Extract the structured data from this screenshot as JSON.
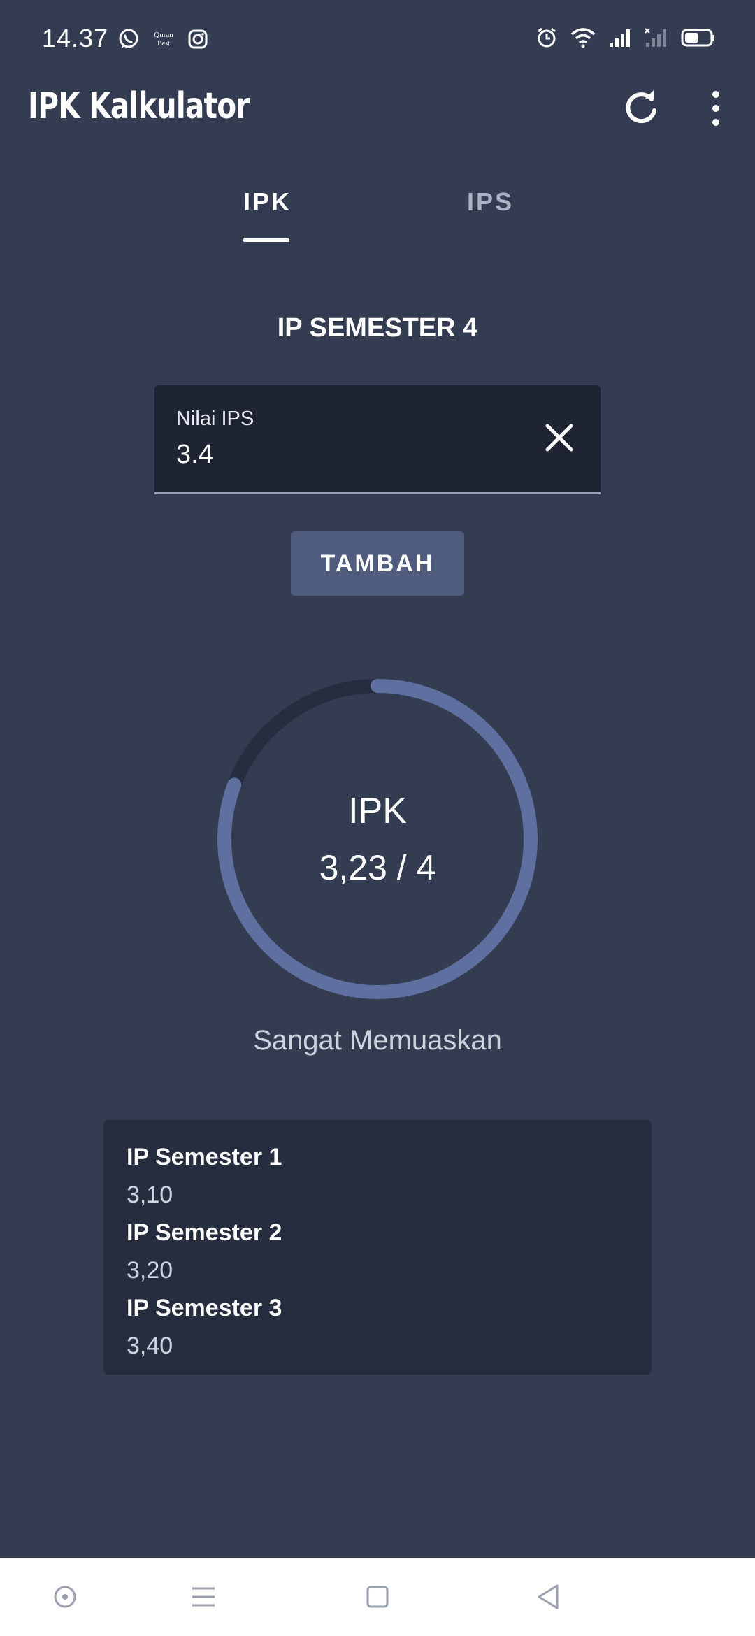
{
  "status_bar": {
    "time": "14.37",
    "app_icons": [
      "whatsapp-icon",
      "quran-best-icon",
      "instagram-icon"
    ],
    "quran_label_top": "Quran",
    "quran_label_bottom": "Best",
    "right_icons": [
      "alarm-icon",
      "wifi-icon",
      "signal-icon",
      "signal-no-service-icon",
      "battery-icon"
    ],
    "battery_level": 0.55
  },
  "app_bar": {
    "title": "IPK Kalkulator",
    "actions": [
      "refresh-icon",
      "more-vert-icon"
    ]
  },
  "tabs": [
    {
      "label": "IPK",
      "selected": true
    },
    {
      "label": "IPS",
      "selected": false
    }
  ],
  "form": {
    "section_title": "IP SEMESTER 4",
    "field_label": "Nilai IPS",
    "field_value": "3.4",
    "add_label": "TAMBAH"
  },
  "result": {
    "label": "IPK",
    "value_text": "3,23 / 4",
    "value": 3.23,
    "max": 4,
    "status": "Sangat Memuaskan"
  },
  "history": [
    {
      "title": "IP Semester 1",
      "value": "3,10"
    },
    {
      "title": "IP Semester 2",
      "value": "3,20"
    },
    {
      "title": "IP Semester 3",
      "value": "3,40"
    }
  ],
  "colors": {
    "background": "#343c52",
    "surface_dark": "#1f2432",
    "card": "#262d3e",
    "accent": "#5f6f9f",
    "track": "#262d3e",
    "button": "#505c7e"
  },
  "nav_bar": [
    "circle-home-icon",
    "menu-icon",
    "square-recents-icon",
    "triangle-back-icon"
  ]
}
